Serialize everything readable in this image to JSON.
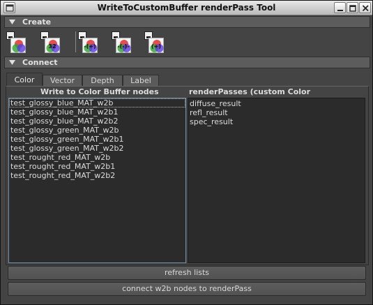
{
  "window": {
    "title": "WriteToCustomBuffer renderPass Tool"
  },
  "sections": {
    "create": "Create",
    "connect": "Connect"
  },
  "tools": [
    {
      "icon": "color-buffer-icon",
      "glyph": ""
    },
    {
      "icon": "color-32-buffer-icon",
      "glyph": "32"
    },
    {
      "icon": "add-buffer-icon",
      "glyph": "-(+)"
    },
    {
      "icon": "remove-buffer-icon",
      "glyph": "-(-)-"
    },
    {
      "icon": "add-buffer-alt-icon",
      "glyph": "(+)"
    }
  ],
  "tabs": [
    "Color",
    "Vector",
    "Depth",
    "Label"
  ],
  "left_list": {
    "header": "Write to Color Buffer nodes",
    "items": [
      "test_glossy_blue_MAT_w2b",
      "test_glossy_blue_MAT_w2b1",
      "test_glossy_blue_MAT_w2b2",
      "test_glossy_green_MAT_w2b",
      "test_glossy_green_MAT_w2b1",
      "test_glossy_green_MAT_w2b2",
      "test_rought_red_MAT_w2b",
      "test_rought_red_MAT_w2b1",
      "test_rought_red_MAT_w2b2"
    ]
  },
  "right_list": {
    "header": "renderPasses (custom Color framebuffers)",
    "items": [
      "diffuse_result",
      "refl_result",
      "spec_result"
    ]
  },
  "buttons": {
    "refresh": "refresh lists",
    "connect": "connect w2b nodes to renderPass"
  }
}
